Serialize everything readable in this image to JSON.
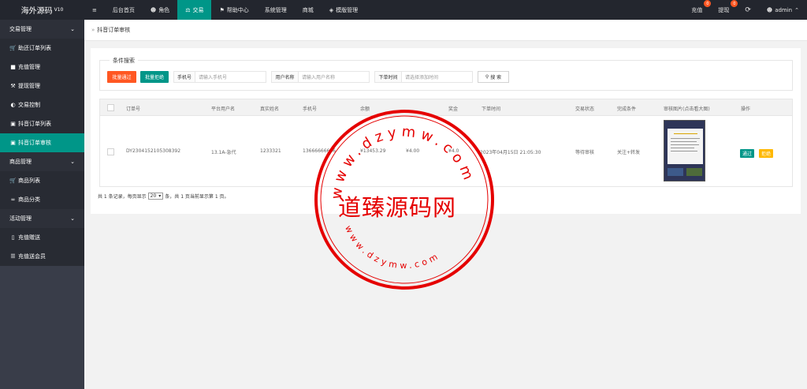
{
  "app": {
    "logo_text": "海外源码",
    "logo_version": "V10"
  },
  "topnav": [
    {
      "label": "≡",
      "icon": ""
    },
    {
      "label": "后台首页",
      "icon": ""
    },
    {
      "label": "角色",
      "icon": "user-icon"
    },
    {
      "label": "交易",
      "icon": "balance-icon",
      "active": true
    },
    {
      "label": "帮助中心",
      "icon": "flag-icon"
    },
    {
      "label": "系统管理",
      "icon": ""
    },
    {
      "label": "商城",
      "icon": ""
    },
    {
      "label": "模版管理",
      "icon": "layers-icon"
    }
  ],
  "topright": {
    "recharge_label": "充值",
    "recharge_badge": "0",
    "withdraw_label": "提现",
    "withdraw_badge": "0",
    "refresh_icon": "refresh-icon",
    "user_label": "admin"
  },
  "sidebar": [
    {
      "type": "group",
      "label": "交易管理"
    },
    {
      "type": "item",
      "label": "助还订单列表",
      "icon": "cart-icon"
    },
    {
      "type": "item",
      "label": "充值管理",
      "icon": "chat-icon"
    },
    {
      "type": "item",
      "label": "提现管理",
      "icon": "hammer-icon"
    },
    {
      "type": "item",
      "label": "交易控制",
      "icon": "gauge-icon"
    },
    {
      "type": "item",
      "label": "抖音订单列表",
      "icon": "lock-icon"
    },
    {
      "type": "item",
      "label": "抖音订单审核",
      "icon": "lock-icon",
      "active": true
    },
    {
      "type": "group",
      "label": "商品管理"
    },
    {
      "type": "item",
      "label": "商品列表",
      "icon": "cart-icon"
    },
    {
      "type": "item",
      "label": "商品分类",
      "icon": "link-icon"
    },
    {
      "type": "group",
      "label": "活动管理"
    },
    {
      "type": "item",
      "label": "充值赠送",
      "icon": "phone-icon"
    },
    {
      "type": "item",
      "label": "充值送会员",
      "icon": "list-icon"
    }
  ],
  "breadcrumb": {
    "separator": "»",
    "current": "抖音订单审核"
  },
  "search": {
    "legend": "条件搜索",
    "batch_approve": "批量通过",
    "batch_reject": "批量拒绝",
    "phone_label": "手机号",
    "phone_placeholder": "请输入手机号",
    "username_label": "用户名称",
    "username_placeholder": "请输入用户名称",
    "time_label": "下单时间",
    "time_placeholder": "请选择添加时间",
    "search_button": "搜 索"
  },
  "table": {
    "headers": [
      "订单号",
      "平台用户名",
      "真实姓名",
      "手机号",
      "余额",
      "",
      "奖金",
      "下单时间",
      "交易状态",
      "完成条件",
      "审核图片(点击看大图)",
      "操作"
    ],
    "row": {
      "order_no": "DY2304152105308392",
      "platform_user": "13.1A-急代",
      "real_name": "1233321",
      "phone": "13666666666",
      "balance": "¥13453.29",
      "amount": "¥4.00",
      "bonus": "¥4.0",
      "order_time": "2023年04月15日 21:05:30",
      "status": "等待审核",
      "condition": "关注+转发",
      "approve_label": "通过",
      "reject_label": "拒绝"
    }
  },
  "pager": {
    "prefix": "共 1 条记录，每页显示",
    "page_size": "20",
    "suffix": "条，共 1 页当前显示第 1 页。"
  },
  "watermark": {
    "center_text": "道臻源码网",
    "top_text": "www.dzymw.com",
    "bottom_text": "www.dzymw.com",
    "color": "#e50000"
  }
}
